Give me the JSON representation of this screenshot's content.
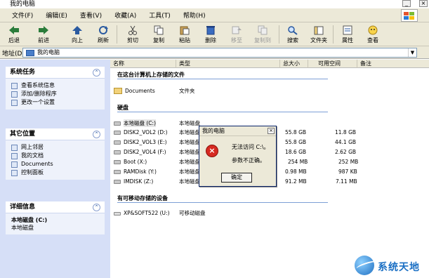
{
  "window": {
    "title": "我的电脑"
  },
  "menu": [
    "文件(F)",
    "编辑(E)",
    "查看(V)",
    "收藏(A)",
    "工具(T)",
    "帮助(H)"
  ],
  "toolbar": {
    "back": "后退",
    "forward": "前进",
    "up": "向上",
    "refresh": "刷新",
    "cut": "剪切",
    "copy": "复制",
    "paste": "粘贴",
    "delete": "删除",
    "move_to": "移至",
    "copy_to": "复制到",
    "search": "搜索",
    "folders": "文件夹",
    "properties": "属性",
    "view": "查看"
  },
  "address": {
    "label": "地址(D)",
    "value": "我的电脑"
  },
  "sidebar": {
    "system_tasks": {
      "title": "系统任务",
      "items": [
        "查看系统信息",
        "添加/删除程序",
        "更改一个设置"
      ]
    },
    "other_places": {
      "title": "其它位置",
      "items": [
        "网上邻居",
        "我的文档",
        "Documents",
        "控制面板"
      ]
    },
    "details": {
      "title": "详细信息",
      "name": "本地磁盘 (C:)",
      "type": "本地磁盘"
    }
  },
  "columns": [
    "名称",
    "类型",
    "总大小",
    "可用空间",
    "备注"
  ],
  "groups": {
    "stored": "在这台计算机上存储的文件",
    "harddisk": "硬盘",
    "removable": "有可移动存储的设备"
  },
  "stored_files": [
    {
      "name": "Documents",
      "type": "文件夹"
    }
  ],
  "drives": [
    {
      "name": "本地磁盘 (C:)",
      "type": "本地磁盘",
      "total": "",
      "free": ""
    },
    {
      "name": "DISK2_VOL2 (D:)",
      "type": "本地磁盘",
      "total": "55.8 GB",
      "free": "11.8 GB"
    },
    {
      "name": "DISK2_VOL3 (E:)",
      "type": "本地磁盘",
      "total": "55.8 GB",
      "free": "44.1 GB"
    },
    {
      "name": "DISK2_VOL4 (F:)",
      "type": "本地磁盘",
      "total": "18.6 GB",
      "free": "2.62 GB"
    },
    {
      "name": "Boot (X:)",
      "type": "本地磁盘",
      "total": "254 MB",
      "free": "252 MB"
    },
    {
      "name": "RAMDisk (Y:)",
      "type": "本地磁盘",
      "total": "0.98 MB",
      "free": "987 KB"
    },
    {
      "name": "IMDISK (Z:)",
      "type": "本地磁盘",
      "total": "91.2 MB",
      "free": "7.11 MB"
    }
  ],
  "removable": [
    {
      "name": "XP&SOFT522 (U:)",
      "type": "可移动磁盘"
    }
  ],
  "dialog": {
    "title": "我的电脑",
    "message1": "无法访问 C:\\。",
    "message2": "参数不正确。",
    "ok": "确定"
  },
  "watermark": "系统天地"
}
